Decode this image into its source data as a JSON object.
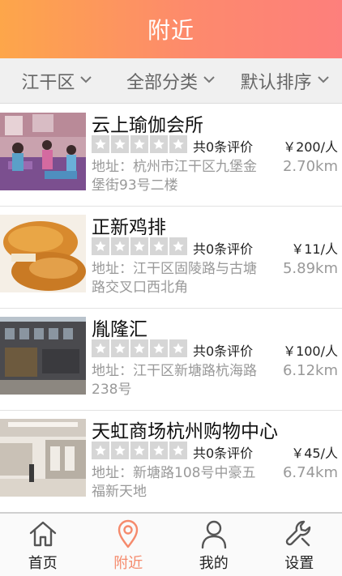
{
  "header": {
    "title": "附近"
  },
  "filters": [
    {
      "label": "江干区",
      "icon": "chevron-down-icon"
    },
    {
      "label": "全部分类",
      "icon": "chevron-down-icon"
    },
    {
      "label": "默认排序",
      "icon": "chevron-down-icon"
    }
  ],
  "rating_icon": "star-icon",
  "items": [
    {
      "name": "云上瑜伽会所",
      "reviews": "共0条评价",
      "price": "￥200/人",
      "address": "地址：杭州市江干区九堡金堡街93号二楼",
      "distance": "2.70km",
      "rating": 0
    },
    {
      "name": "正新鸡排",
      "reviews": "共0条评价",
      "price": "￥11/人",
      "address": "地址：江干区固陵路与古塘路交叉口西北角",
      "distance": "5.89km",
      "rating": 0
    },
    {
      "name": "胤隆汇",
      "reviews": "共0条评价",
      "price": "￥100/人",
      "address": "地址：江干区新塘路杭海路238号",
      "distance": "6.12km",
      "rating": 0
    },
    {
      "name": "天虹商场杭州购物中心",
      "reviews": "共0条评价",
      "price": "￥45/人",
      "address": "地址：新塘路108号中豪五福新天地",
      "distance": "6.74km",
      "rating": 0
    }
  ],
  "tabs": [
    {
      "label": "首页",
      "icon": "home-icon",
      "active": false
    },
    {
      "label": "附近",
      "icon": "location-pin-icon",
      "active": true
    },
    {
      "label": "我的",
      "icon": "user-icon",
      "active": false
    },
    {
      "label": "设置",
      "icon": "wrench-icon",
      "active": false
    }
  ],
  "colors": {
    "accent": "#f58a6c",
    "header_start": "#fda64a",
    "header_end": "#fd7f7c",
    "inactive_icon": "#555555",
    "star_bg": "#d6d6d6"
  }
}
